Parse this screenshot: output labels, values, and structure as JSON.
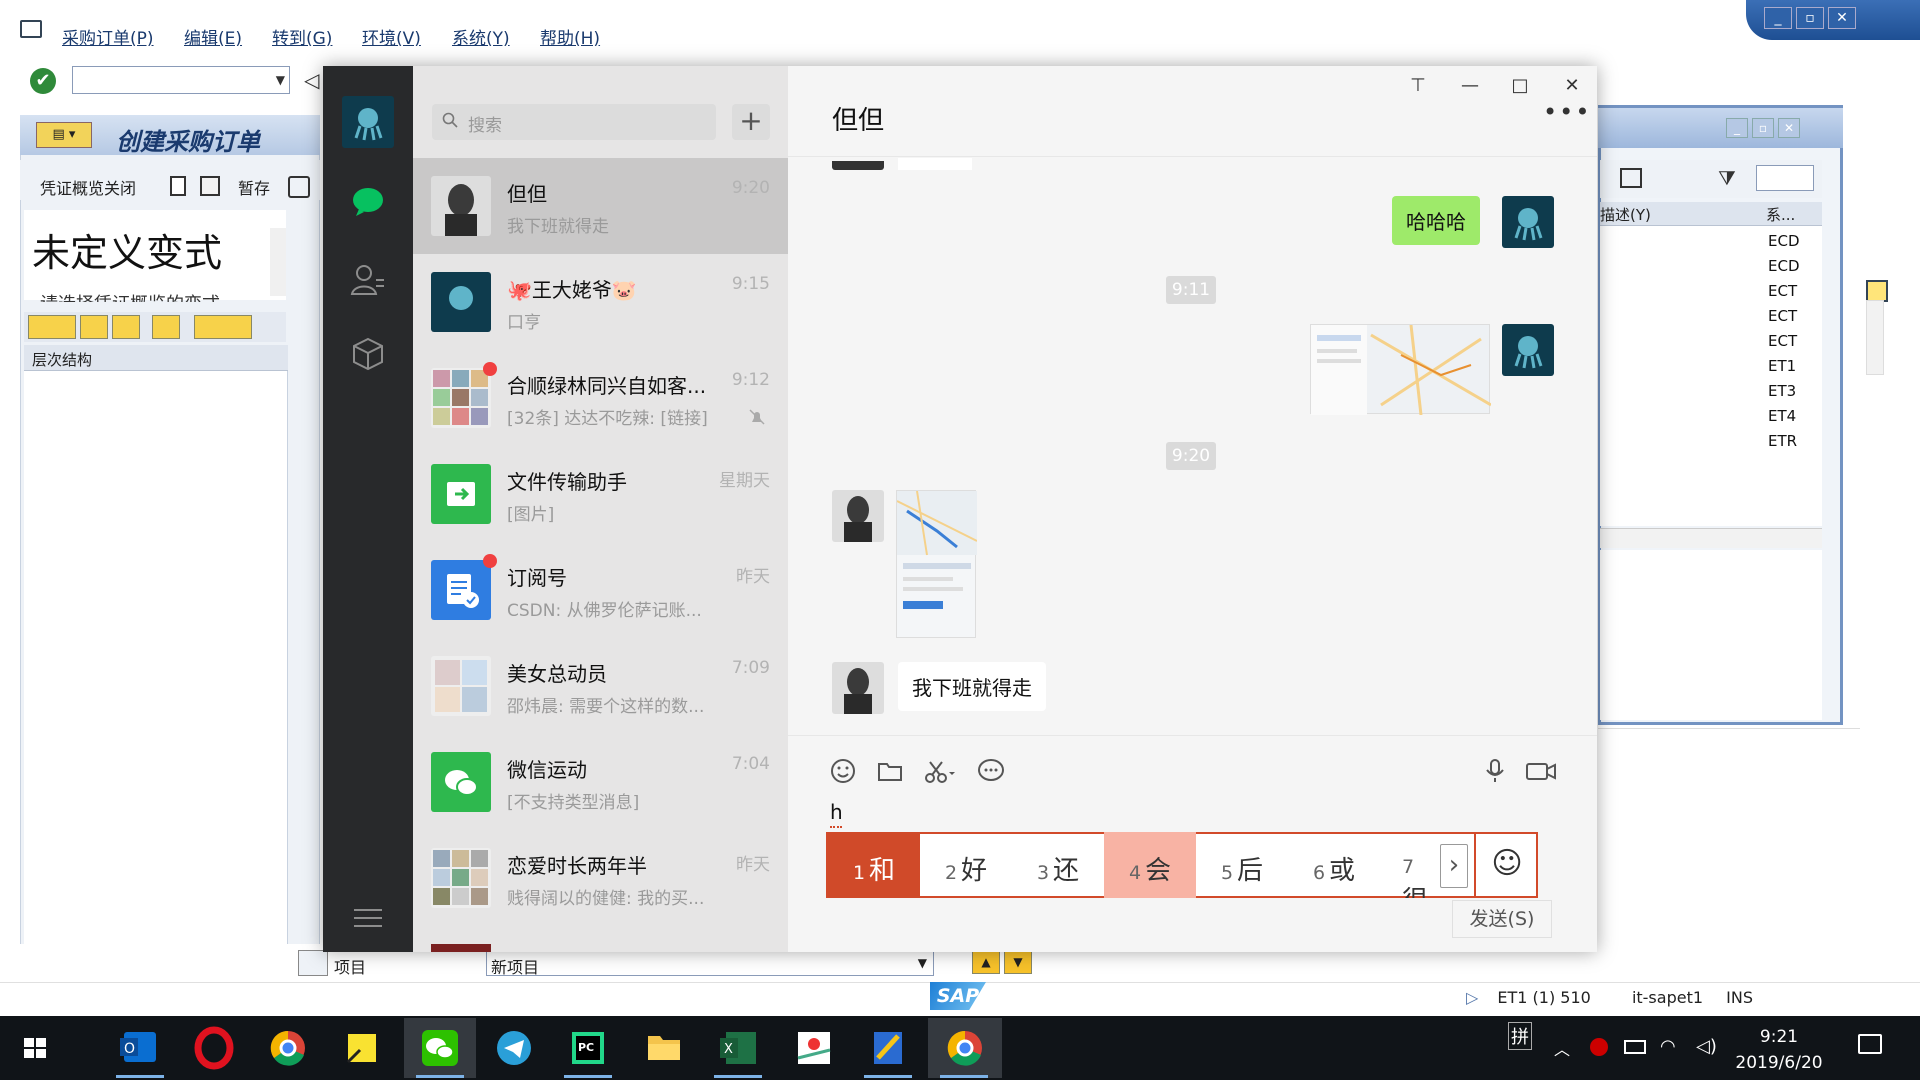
{
  "sap": {
    "menu": [
      {
        "label": "采购订单(P)"
      },
      {
        "label": "编辑(E)"
      },
      {
        "label": "转到(G)"
      },
      {
        "label": "环境(V)"
      },
      {
        "label": "系统(Y)"
      },
      {
        "label": "帮助(H)"
      }
    ],
    "title": "创建采购订单",
    "app_toolbar": {
      "close_overview": "凭证概览关闭",
      "hold": "暂存"
    },
    "variant": "未定义变式",
    "variant_sub": "请选择凭证概览的变式",
    "hierarchy_label": "层次结构",
    "popup": {
      "col_header": "描述(Y)",
      "col_header2": "系...",
      "rows": [
        "ECD",
        "ECD",
        "ECT",
        "ECT",
        "ECT",
        "ET1",
        "ET3",
        "ET4",
        "ETR"
      ]
    },
    "item_label": "项目",
    "new_item": "新项目",
    "status": {
      "system": "ET1 (1) 510",
      "server": "it-sapet1",
      "mode": "INS"
    },
    "logo": "SAP"
  },
  "wechat": {
    "search_placeholder": "搜索",
    "add_label": "+",
    "chat_title": "但但",
    "conversations": [
      {
        "name": "但但",
        "time": "9:20",
        "preview": "我下班就得走",
        "active": true
      },
      {
        "name": "🐙王大姥爷🐷",
        "time": "9:15",
        "preview": "口亨"
      },
      {
        "name": "合顺绿林同兴自如客...",
        "time": "9:12",
        "preview": "[32条] 达达不吃辣: [链接]",
        "unread": true,
        "muted": true
      },
      {
        "name": "文件传输助手",
        "time": "星期天",
        "preview": "[图片]"
      },
      {
        "name": "订阅号",
        "time": "昨天",
        "preview": "CSDN: 从佛罗伦萨记账...",
        "unread": true
      },
      {
        "name": "美女总动员",
        "time": "7:09",
        "preview": "邵炜晨: 需要个这样的数..."
      },
      {
        "name": "微信运动",
        "time": "7:04",
        "preview": "[不支持类型消息]"
      },
      {
        "name": "恋爱时长两年半",
        "time": "昨天",
        "preview": "贱得阔以的健健: 我的买..."
      }
    ],
    "messages": {
      "me_text": "哈哈哈",
      "time1": "9:11",
      "time2": "9:20",
      "them_text": "我下班就得走"
    },
    "typed": "h",
    "ime_candidates": [
      {
        "num": "1",
        "text": "和"
      },
      {
        "num": "2",
        "text": "好"
      },
      {
        "num": "3",
        "text": "还"
      },
      {
        "num": "4",
        "text": "会"
      },
      {
        "num": "5",
        "text": "后"
      },
      {
        "num": "6",
        "text": "或"
      },
      {
        "num": "7",
        "text": "很"
      }
    ],
    "send_label": "发送(S)",
    "colors": {
      "accent": "#07c160",
      "bubble_me": "#9eea6a",
      "ime_selected": "#d04a29"
    }
  },
  "taskbar": {
    "ime_indicator": "拼",
    "time": "9:21",
    "date": "2019/6/20"
  }
}
